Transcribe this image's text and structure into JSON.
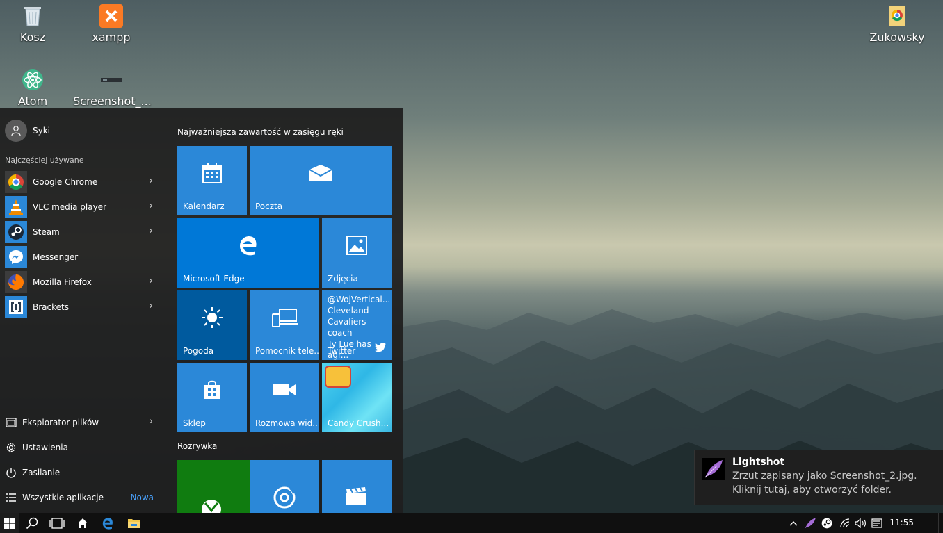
{
  "desktop": {
    "icons": [
      {
        "label": "Kosz"
      },
      {
        "label": "xampp"
      },
      {
        "label": "Zukowsky"
      },
      {
        "label": "Atom"
      },
      {
        "label": "Screenshot_..."
      }
    ]
  },
  "start": {
    "user": "Syki",
    "most_used_label": "Najczęściej używane",
    "apps": [
      {
        "label": "Google Chrome",
        "icon": "chrome-icon"
      },
      {
        "label": "VLC media player",
        "icon": "vlc-icon"
      },
      {
        "label": "Steam",
        "icon": "steam-icon"
      },
      {
        "label": "Messenger",
        "icon": "messenger-icon"
      },
      {
        "label": "Mozilla Firefox",
        "icon": "firefox-icon"
      },
      {
        "label": "Brackets",
        "icon": "brackets-icon"
      }
    ],
    "bottom": [
      {
        "label": "Eksplorator plików"
      },
      {
        "label": "Ustawienia"
      },
      {
        "label": "Zasilanie"
      },
      {
        "label": "Wszystkie aplikacje",
        "badge": "Nowa"
      }
    ],
    "group1_title": "Najważniejsza zawartość w zasięgu ręki",
    "group2_title": "Rozrywka",
    "tiles": {
      "calendar": "Kalendarz",
      "mail": "Poczta",
      "edge": "Microsoft Edge",
      "photos": "Zdjęcia",
      "weather": "Pogoda",
      "phone": "Pomocnik tele...",
      "twitter_lines": [
        "@WojVertical...",
        "Cleveland",
        "Cavaliers coach",
        "Ty Lue has agr..."
      ],
      "twitter": "Twitter",
      "store": "Sklep",
      "video_call": "Rozmowa wid...",
      "candy": "Candy Crush..."
    }
  },
  "toast": {
    "title": "Lightshot",
    "line1": "Zrzut zapisany jako Screenshot_2.jpg.",
    "line2": "Kliknij tutaj, aby otworzyć folder."
  },
  "taskbar": {
    "clock": "11:55"
  },
  "colors": {
    "tile_blue": "#2b88d8",
    "edge_blue": "#0078d7",
    "weather_blue": "#005a9e",
    "xbox_green": "#107c10",
    "accent_link": "#4aa3ff"
  }
}
